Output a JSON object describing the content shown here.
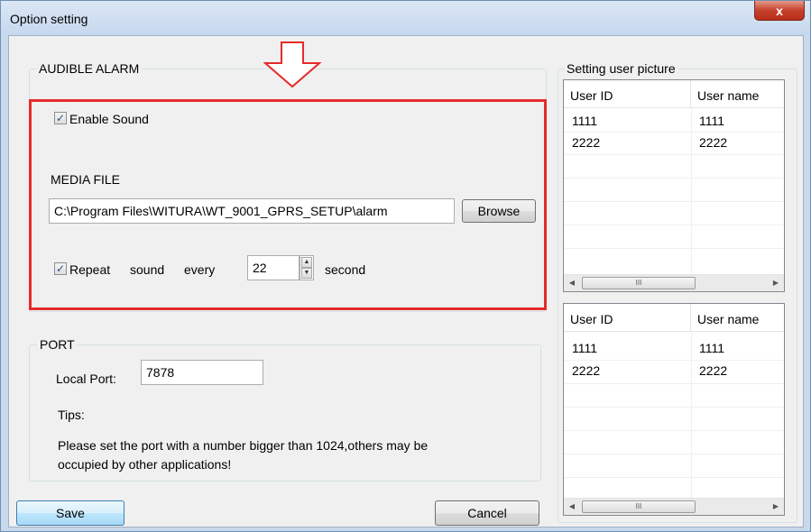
{
  "window": {
    "title": "Option setting",
    "close_glyph": "x"
  },
  "audible_alarm": {
    "legend": "AUDIBLE ALARM",
    "enable_sound": {
      "label": "Enable Sound",
      "checked": true
    },
    "media_file_label": "MEDIA FILE",
    "media_file_path": "C:\\Program Files\\WITURA\\WT_9001_GPRS_SETUP\\alarm",
    "browse_label": "Browse",
    "repeat": {
      "checked": true,
      "word1": "Repeat",
      "word2": "sound",
      "word3": "every",
      "interval": "22",
      "unit": "second"
    }
  },
  "port": {
    "legend": "PORT",
    "local_port_label": "Local Port:",
    "local_port_value": "7878",
    "tips_label": "Tips:",
    "tips_text_line1": "Please set the port with a number bigger than 1024,others may be",
    "tips_text_line2": "occupied by other applications!"
  },
  "buttons": {
    "save": "Save",
    "cancel": "Cancel"
  },
  "user_picture": {
    "legend": "Setting user picture",
    "list1": {
      "columns": [
        "User ID",
        "User name"
      ],
      "rows": [
        [
          "1111",
          "1111"
        ],
        [
          "2222",
          "2222"
        ]
      ]
    },
    "list2": {
      "columns": [
        "User ID",
        "User name"
      ],
      "rows": [
        [
          "1111",
          "1111"
        ],
        [
          "2222",
          "2222"
        ]
      ]
    },
    "scroll_thumb_glyph": "III"
  },
  "colors": {
    "highlight_frame": "#e52b2b",
    "title_bar": "#c6d8ee",
    "dialog_bg": "#f0f0f0"
  },
  "icons": {
    "checkbox_check": "check-icon",
    "spin_up": "caret-up-icon",
    "spin_down": "caret-down-icon",
    "annotation_arrow": "down-arrow-icon"
  }
}
